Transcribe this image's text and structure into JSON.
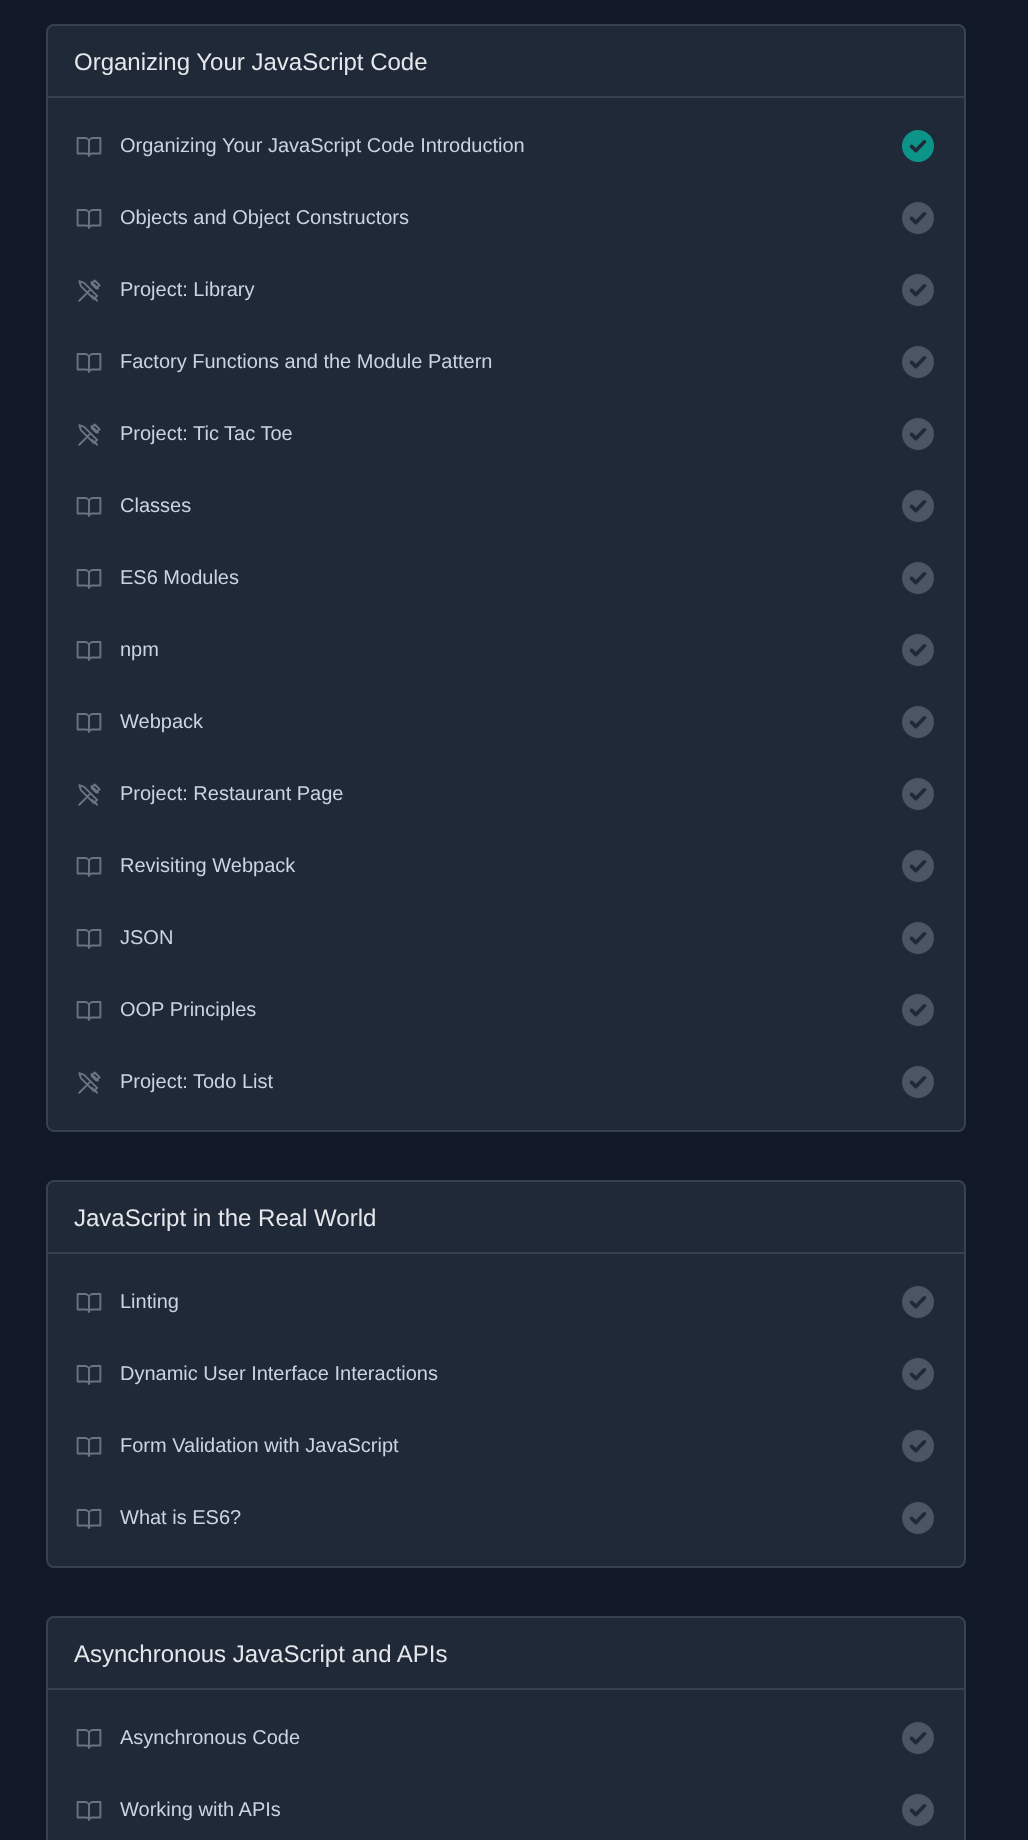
{
  "sections": [
    {
      "title": "Organizing Your JavaScript Code",
      "lessons": [
        {
          "kind": "lesson",
          "title": "Organizing Your JavaScript Code Introduction",
          "completed": true
        },
        {
          "kind": "lesson",
          "title": "Objects and Object Constructors",
          "completed": false
        },
        {
          "kind": "project",
          "title": "Project: Library",
          "completed": false
        },
        {
          "kind": "lesson",
          "title": "Factory Functions and the Module Pattern",
          "completed": false
        },
        {
          "kind": "project",
          "title": "Project: Tic Tac Toe",
          "completed": false
        },
        {
          "kind": "lesson",
          "title": "Classes",
          "completed": false
        },
        {
          "kind": "lesson",
          "title": "ES6 Modules",
          "completed": false
        },
        {
          "kind": "lesson",
          "title": "npm",
          "completed": false
        },
        {
          "kind": "lesson",
          "title": "Webpack",
          "completed": false
        },
        {
          "kind": "project",
          "title": "Project: Restaurant Page",
          "completed": false
        },
        {
          "kind": "lesson",
          "title": "Revisiting Webpack",
          "completed": false
        },
        {
          "kind": "lesson",
          "title": "JSON",
          "completed": false
        },
        {
          "kind": "lesson",
          "title": "OOP Principles",
          "completed": false
        },
        {
          "kind": "project",
          "title": "Project: Todo List",
          "completed": false
        }
      ]
    },
    {
      "title": "JavaScript in the Real World",
      "lessons": [
        {
          "kind": "lesson",
          "title": "Linting",
          "completed": false
        },
        {
          "kind": "lesson",
          "title": "Dynamic User Interface Interactions",
          "completed": false
        },
        {
          "kind": "lesson",
          "title": "Form Validation with JavaScript",
          "completed": false
        },
        {
          "kind": "lesson",
          "title": "What is ES6?",
          "completed": false
        }
      ]
    },
    {
      "title": "Asynchronous JavaScript and APIs",
      "lessons": [
        {
          "kind": "lesson",
          "title": "Asynchronous Code",
          "completed": false
        },
        {
          "kind": "lesson",
          "title": "Working with APIs",
          "completed": false
        }
      ]
    }
  ]
}
